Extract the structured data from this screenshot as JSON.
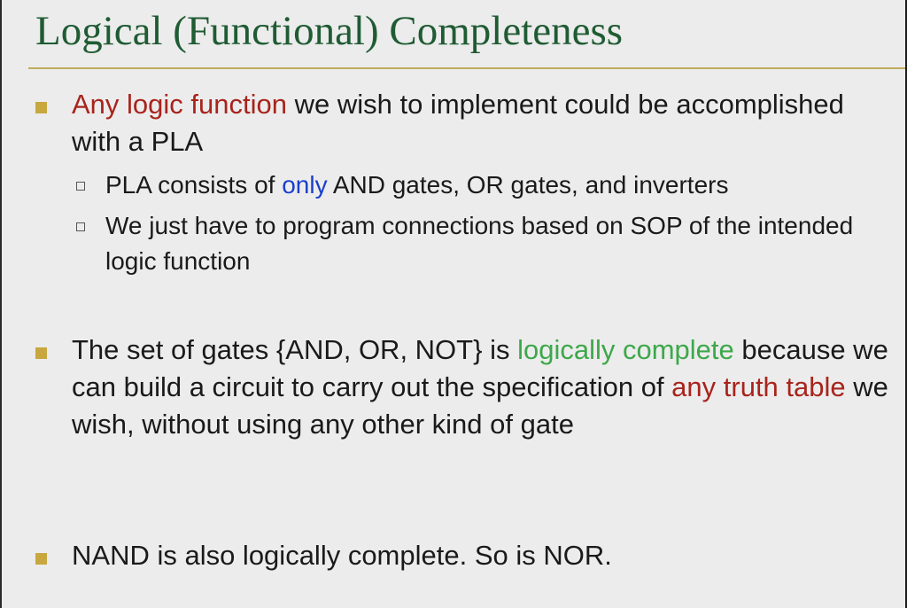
{
  "title": "Logical (Functional) Completeness",
  "colors": {
    "title": "#1f5b33",
    "rule": "#c0ab5a",
    "bullet_marker": "#c8a73f",
    "emphasis_red": "#a8241c",
    "emphasis_blue": "#1b3fcc",
    "emphasis_green": "#3da84a"
  },
  "bullets": [
    {
      "highlight": "Any logic function",
      "rest": " we wish to implement could be accomplished with a PLA",
      "subs": [
        {
          "before": "PLA consists of ",
          "highlight": "only",
          "after": " AND gates, OR gates, and inverters"
        },
        {
          "text": "We just have to program connections based on SOP of the intended logic function"
        }
      ]
    },
    {
      "before": "The set of gates {AND, OR, NOT} is ",
      "highlight_green": "logically complete",
      "middle": " because we can build a circuit to carry out the specification of ",
      "highlight_red": "any truth table",
      "after": " we wish, without using any other kind of gate"
    },
    {
      "text": "NAND is also logically complete. So is NOR."
    }
  ]
}
